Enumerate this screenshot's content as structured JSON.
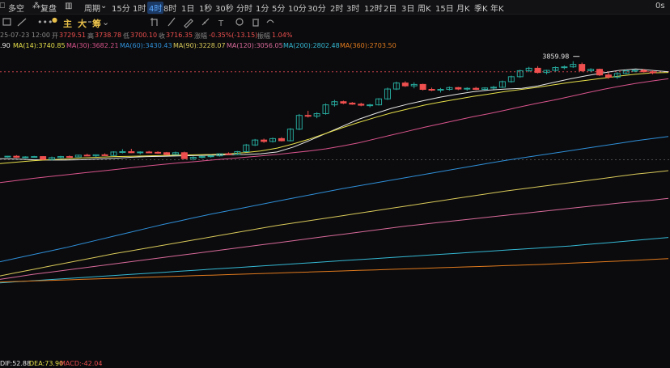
{
  "topbar": {
    "more_label": "多空",
    "review_label": "复盘",
    "period_label": "周期",
    "timeframes": [
      "15分",
      "1时",
      "4时",
      "8时",
      "1日",
      "1秒",
      "30秒",
      "分时",
      "1分",
      "5分",
      "10分",
      "30分",
      "2时",
      "3时",
      "12时",
      "2日",
      "3日",
      "周K",
      "15日",
      "月K",
      "季K",
      "年K"
    ],
    "active_timeframe_index": 2,
    "right_label": "0s"
  },
  "toolbar": {
    "indicator_main": "主",
    "indicator_big": "大",
    "indicator_chip": "筹",
    "more_dots": "•••"
  },
  "infobar": {
    "datetime": "25-07-23 12:00",
    "open_label": "开",
    "open": "3729.51",
    "high_label": "高",
    "high": "3738.78",
    "low_label": "低",
    "low": "3700.10",
    "close_label": "收",
    "close": "3716.35",
    "change_label": "涨幅",
    "change": "-0.35%(-13.15)",
    "amp_label": "振幅",
    "amp": "1.04%"
  },
  "mabar": {
    "prefix": ".90",
    "ma14": "MA(14):3740.85",
    "ma30": "MA(30):3682.21",
    "ma60": "MA(60):3430.43",
    "ma90": "MA(90):3228.07",
    "ma120": "MA(120):3056.05",
    "ma200": "MA(200):2802.48",
    "ma360": "MA(360):2703.50"
  },
  "macdbar": {
    "dif": "DIF:52.88",
    "dea": "DEA:73.90",
    "macd": "MACD:-42.04"
  },
  "colors": {
    "up": "#26a69a",
    "down": "#ef4f4f",
    "ma14": "#e8e8e8",
    "ma30": "#e6df4a",
    "ma60": "#d9548c",
    "ma90": "#2f8fd8",
    "ma120": "#d9c95a",
    "ma200": "#d86a9a",
    "ma360": "#35b9d4",
    "ma_long": "#e07a1e",
    "dif": "#e8e8e8",
    "dea": "#e6df4a",
    "macd": "#ef4f4f"
  },
  "chart_data": {
    "type": "candlestick",
    "annotations": [
      {
        "label": "3859.98",
        "type": "high_marker"
      }
    ],
    "price_scale": {
      "min": 2300,
      "max": 3900
    },
    "candles": [
      [
        3318,
        3322,
        3312,
        3320
      ],
      [
        3320,
        3326,
        3310,
        3314
      ],
      [
        3314,
        3320,
        3308,
        3316
      ],
      [
        3316,
        3322,
        3312,
        3318
      ],
      [
        3318,
        3320,
        3298,
        3302
      ],
      [
        3302,
        3318,
        3296,
        3312
      ],
      [
        3312,
        3322,
        3308,
        3318
      ],
      [
        3318,
        3324,
        3312,
        3316
      ],
      [
        3316,
        3328,
        3314,
        3326
      ],
      [
        3326,
        3334,
        3320,
        3322
      ],
      [
        3322,
        3330,
        3316,
        3328
      ],
      [
        3328,
        3336,
        3322,
        3324
      ],
      [
        3324,
        3348,
        3322,
        3344
      ],
      [
        3344,
        3360,
        3336,
        3346
      ],
      [
        3346,
        3362,
        3338,
        3340
      ],
      [
        3340,
        3348,
        3330,
        3344
      ],
      [
        3344,
        3350,
        3338,
        3342
      ],
      [
        3342,
        3348,
        3334,
        3340
      ],
      [
        3340,
        3344,
        3326,
        3330
      ],
      [
        3330,
        3346,
        3328,
        3340
      ],
      [
        3340,
        3346,
        3318,
        3306
      ],
      [
        3306,
        3320,
        3296,
        3314
      ],
      [
        3314,
        3322,
        3308,
        3318
      ],
      [
        3318,
        3326,
        3312,
        3322
      ],
      [
        3322,
        3336,
        3318,
        3334
      ],
      [
        3334,
        3342,
        3326,
        3330
      ],
      [
        3330,
        3350,
        3328,
        3346
      ],
      [
        3346,
        3390,
        3342,
        3384
      ],
      [
        3384,
        3418,
        3378,
        3412
      ],
      [
        3412,
        3420,
        3396,
        3404
      ],
      [
        3404,
        3426,
        3398,
        3420
      ],
      [
        3420,
        3428,
        3404,
        3408
      ],
      [
        3408,
        3480,
        3404,
        3474
      ],
      [
        3474,
        3560,
        3468,
        3552
      ],
      [
        3552,
        3578,
        3540,
        3548
      ],
      [
        3548,
        3570,
        3536,
        3562
      ],
      [
        3562,
        3620,
        3556,
        3612
      ],
      [
        3612,
        3640,
        3602,
        3630
      ],
      [
        3630,
        3636,
        3616,
        3622
      ],
      [
        3622,
        3628,
        3612,
        3616
      ],
      [
        3616,
        3624,
        3604,
        3610
      ],
      [
        3610,
        3618,
        3598,
        3612
      ],
      [
        3612,
        3650,
        3608,
        3646
      ],
      [
        3646,
        3710,
        3640,
        3702
      ],
      [
        3702,
        3744,
        3696,
        3736
      ],
      [
        3736,
        3746,
        3714,
        3720
      ],
      [
        3720,
        3740,
        3706,
        3728
      ],
      [
        3728,
        3732,
        3694,
        3700
      ],
      [
        3700,
        3710,
        3690,
        3696
      ],
      [
        3696,
        3708,
        3682,
        3700
      ],
      [
        3700,
        3716,
        3694,
        3710
      ],
      [
        3710,
        3714,
        3696,
        3702
      ],
      [
        3702,
        3712,
        3692,
        3706
      ],
      [
        3706,
        3714,
        3696,
        3700
      ],
      [
        3700,
        3712,
        3696,
        3708
      ],
      [
        3708,
        3720,
        3700,
        3712
      ],
      [
        3712,
        3750,
        3708,
        3744
      ],
      [
        3744,
        3778,
        3738,
        3772
      ],
      [
        3772,
        3812,
        3766,
        3806
      ],
      [
        3806,
        3828,
        3798,
        3820
      ],
      [
        3820,
        3832,
        3790,
        3796
      ],
      [
        3796,
        3812,
        3786,
        3808
      ],
      [
        3808,
        3830,
        3802,
        3824
      ],
      [
        3824,
        3836,
        3814,
        3828
      ],
      [
        3828,
        3860,
        3822,
        3842
      ],
      [
        3842,
        3852,
        3800,
        3806
      ],
      [
        3806,
        3820,
        3798,
        3814
      ],
      [
        3814,
        3818,
        3776,
        3782
      ],
      [
        3782,
        3796,
        3760,
        3770
      ],
      [
        3770,
        3798,
        3760,
        3790
      ],
      [
        3790,
        3812,
        3786,
        3806
      ],
      [
        3806,
        3814,
        3798,
        3808
      ],
      [
        3808,
        3816,
        3796,
        3800
      ],
      [
        3800,
        3808,
        3786,
        3794
      ]
    ],
    "ma_lines": [
      {
        "key": "ma14",
        "values": [
          3306,
          3304,
          3300,
          3298,
          3298,
          3300,
          3304,
          3308,
          3314,
          3318,
          3320,
          3322,
          3324,
          3326,
          3328,
          3330,
          3334,
          3344,
          3372,
          3410,
          3450,
          3490,
          3530,
          3562,
          3592,
          3616,
          3636,
          3656,
          3672,
          3686,
          3696,
          3702,
          3706,
          3720,
          3740,
          3760,
          3778,
          3794,
          3808,
          3816,
          3808,
          3800
        ]
      },
      {
        "key": "ma30",
        "values": [
          3278,
          3286,
          3294,
          3300,
          3304,
          3310,
          3314,
          3318,
          3320,
          3322,
          3324,
          3326,
          3328,
          3330,
          3334,
          3340,
          3350,
          3366,
          3390,
          3418,
          3450,
          3482,
          3512,
          3540,
          3566,
          3588,
          3610,
          3628,
          3644,
          3660,
          3674,
          3688,
          3700,
          3712,
          3726,
          3740,
          3752,
          3764,
          3776,
          3786,
          3794,
          3796
        ]
      },
      {
        "key": "ma60",
        "values": [
          3170,
          3182,
          3194,
          3204,
          3214,
          3224,
          3234,
          3244,
          3254,
          3264,
          3274,
          3282,
          3290,
          3298,
          3306,
          3314,
          3322,
          3330,
          3340,
          3350,
          3362,
          3378,
          3396,
          3418,
          3440,
          3462,
          3484,
          3504,
          3524,
          3544,
          3562,
          3582,
          3602,
          3622,
          3640,
          3660,
          3680,
          3700,
          3718,
          3734,
          3748,
          3760
        ]
      },
      {
        "key": "ma90",
        "values": [
          2720,
          2740,
          2760,
          2780,
          2800,
          2822,
          2844,
          2866,
          2888,
          2910,
          2932,
          2952,
          2972,
          2992,
          3010,
          3028,
          3046,
          3064,
          3082,
          3100,
          3118,
          3136,
          3152,
          3168,
          3184,
          3200,
          3216,
          3232,
          3248,
          3264,
          3280,
          3296,
          3310,
          3324,
          3338,
          3352,
          3366,
          3380,
          3394,
          3408,
          3420,
          3432
        ]
      },
      {
        "key": "ma120",
        "values": [
          2640,
          2658,
          2676,
          2694,
          2712,
          2730,
          2748,
          2766,
          2782,
          2798,
          2814,
          2830,
          2846,
          2862,
          2878,
          2894,
          2910,
          2926,
          2940,
          2954,
          2968,
          2982,
          2996,
          3010,
          3024,
          3038,
          3052,
          3066,
          3080,
          3094,
          3108,
          3122,
          3134,
          3146,
          3158,
          3170,
          3182,
          3194,
          3206,
          3218,
          3228,
          3238
        ]
      },
      {
        "key": "ma200",
        "values": [
          2620,
          2634,
          2648,
          2660,
          2672,
          2684,
          2696,
          2708,
          2720,
          2732,
          2744,
          2756,
          2768,
          2780,
          2792,
          2804,
          2816,
          2828,
          2840,
          2852,
          2864,
          2876,
          2888,
          2900,
          2912,
          2924,
          2934,
          2944,
          2954,
          2964,
          2974,
          2984,
          2994,
          3004,
          3014,
          3024,
          3034,
          3044,
          3054,
          3062,
          3070,
          3080
        ]
      },
      {
        "key": "ma360",
        "values": [
          2600,
          2606,
          2612,
          2618,
          2624,
          2630,
          2636,
          2642,
          2648,
          2654,
          2660,
          2666,
          2672,
          2678,
          2684,
          2690,
          2696,
          2702,
          2708,
          2714,
          2720,
          2726,
          2732,
          2738,
          2744,
          2750,
          2756,
          2762,
          2768,
          2774,
          2780,
          2786,
          2792,
          2798,
          2804,
          2810,
          2818,
          2826,
          2834,
          2842,
          2850,
          2858
        ]
      },
      {
        "key": "ma_long",
        "values": [
          2605,
          2608,
          2611,
          2614,
          2617,
          2620,
          2623,
          2626,
          2629,
          2632,
          2635,
          2638,
          2641,
          2644,
          2647,
          2650,
          2653,
          2656,
          2659,
          2662,
          2665,
          2668,
          2671,
          2674,
          2677,
          2680,
          2683,
          2686,
          2689,
          2692,
          2695,
          2698,
          2701,
          2704,
          2708,
          2712,
          2716,
          2720,
          2724,
          2728,
          2733,
          2738
        ]
      }
    ]
  }
}
